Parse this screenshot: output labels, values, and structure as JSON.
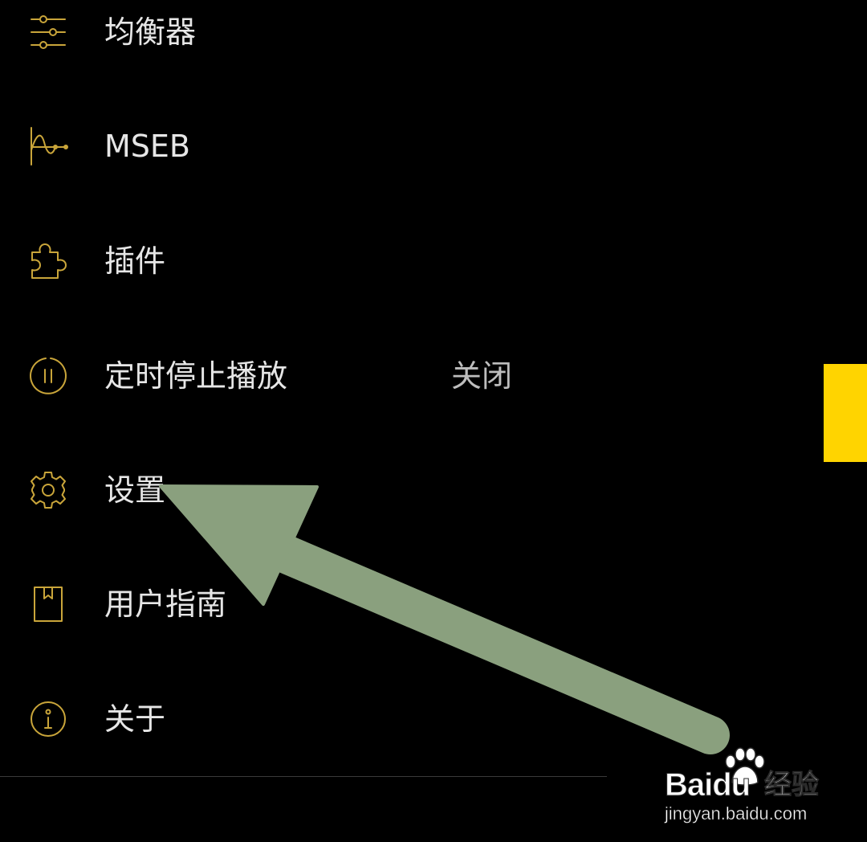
{
  "menu": {
    "items": [
      {
        "id": "equalizer",
        "icon": "equalizer-sliders-icon",
        "label": "均衡器",
        "value": ""
      },
      {
        "id": "mseb",
        "icon": "waveform-curve-icon",
        "label": "MSEB",
        "value": ""
      },
      {
        "id": "plugins",
        "icon": "puzzle-piece-icon",
        "label": "插件",
        "value": ""
      },
      {
        "id": "sleep-timer",
        "icon": "pause-circle-icon",
        "label": "定时停止播放",
        "value": "关闭"
      },
      {
        "id": "settings",
        "icon": "gear-icon",
        "label": "设置",
        "value": ""
      },
      {
        "id": "user-guide",
        "icon": "bookmark-book-icon",
        "label": "用户指南",
        "value": ""
      },
      {
        "id": "about",
        "icon": "info-circle-icon",
        "label": "关于",
        "value": ""
      }
    ]
  },
  "overlay": {
    "arrow_color": "#8aa07e",
    "arrow_target": "settings"
  },
  "watermark": {
    "brand_prefix": "Bai",
    "brand_suffix": "du",
    "brand_cn": "经验",
    "url": "jingyan.baidu.com"
  },
  "colors": {
    "background": "#000000",
    "icon_accent": "#c9a53a",
    "label_text": "#e6e6e6",
    "value_text": "#bdbdbd",
    "side_handle": "#ffd400",
    "divider": "#3a3a3a"
  }
}
